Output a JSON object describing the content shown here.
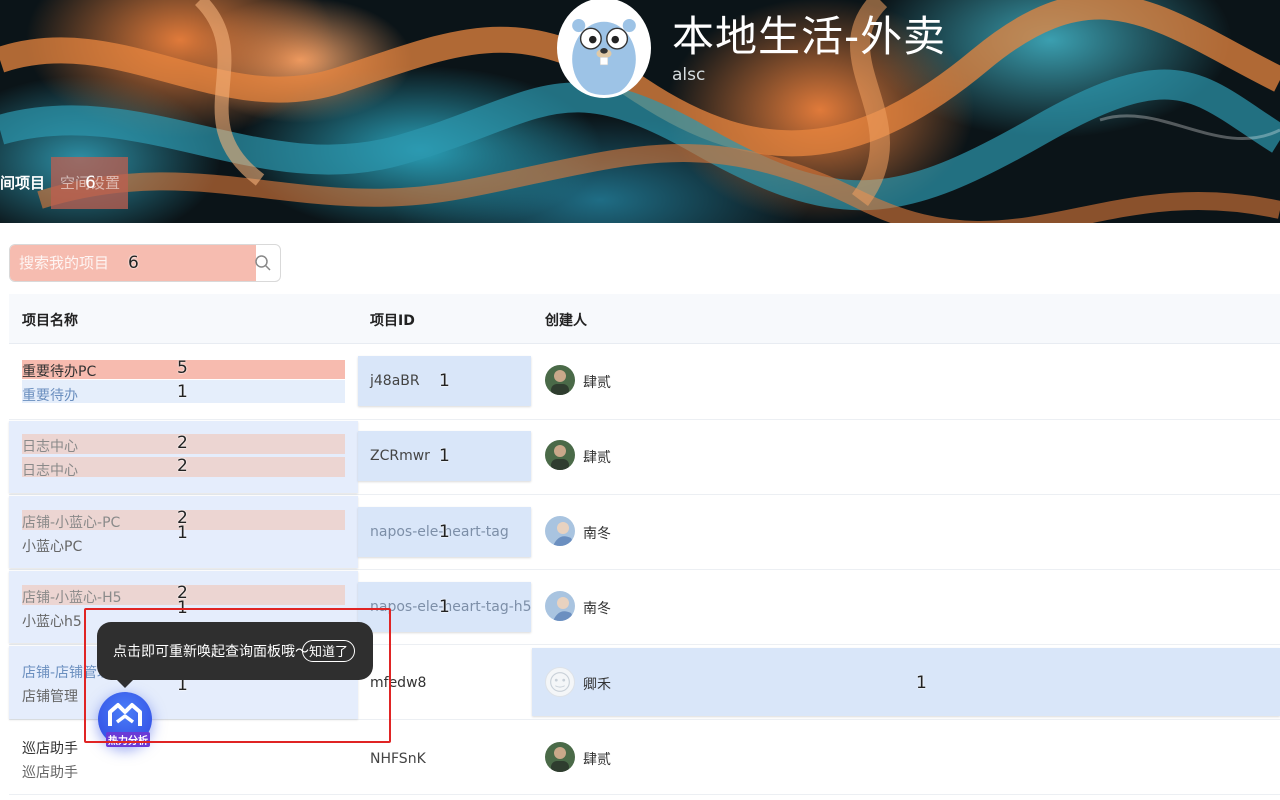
{
  "space": {
    "title": "本地生活-外卖",
    "subtitle": "alsc",
    "avatar_icon": "gopher-avatar-icon"
  },
  "tabs": {
    "active_label": "间项目",
    "settings_label": "空间设置",
    "settings_badge": "6"
  },
  "search": {
    "placeholder": "搜索我的项目",
    "value": "",
    "badge": "6",
    "icon": "search-icon"
  },
  "table": {
    "headers": [
      "项目名称",
      "项目ID",
      "创建人"
    ],
    "rows": [
      {
        "name": "重要待办PC",
        "name_badge": "5",
        "sub": "重要待办",
        "sub_badge": "1",
        "id": "j48aBR",
        "id_badge": "1",
        "creator": "肆贰"
      },
      {
        "name": "日志中心",
        "name_badge": "2",
        "sub": "日志中心",
        "sub_badge": "2",
        "id": "ZCRmwr",
        "id_badge": "1",
        "creator": "肆贰"
      },
      {
        "name": "店铺-小蓝心-PC",
        "name_badge": "2",
        "sub": "小蓝心PC",
        "sub_badge": "1",
        "id": "napos-ele-heart-tag",
        "id_badge": "1",
        "creator": "南冬"
      },
      {
        "name": "店铺-小蓝心-H5",
        "name_badge": "2",
        "sub": "小蓝心h5",
        "sub_badge": "1",
        "id": "napos-ele-heart-tag-h5",
        "id_badge": "1",
        "creator": "南冬"
      },
      {
        "name": "店铺-店铺管理",
        "name_badge": "",
        "sub": "店铺管理",
        "sub_badge": "1",
        "id": "mfedw8",
        "id_badge": "",
        "creator": "卿禾",
        "creator_badge": "1"
      },
      {
        "name": "巡店助手",
        "name_badge": "",
        "sub": "巡店助手",
        "sub_badge": "",
        "id": "NHFSnK",
        "id_badge": "",
        "creator": "肆贰"
      }
    ]
  },
  "tooltip": {
    "text": "点击即可重新唤起查询面板哦～",
    "button_label": "知道了"
  },
  "fab": {
    "label": "热力分析",
    "icon": "heatmap-logo-icon"
  },
  "colors": {
    "highlight_red": "#f6bcb0",
    "highlight_blue": "#d2e2f8",
    "tooltip_bg": "#2f2f2f",
    "fab_blue": "#3757e8",
    "frame_red": "#e02424"
  }
}
